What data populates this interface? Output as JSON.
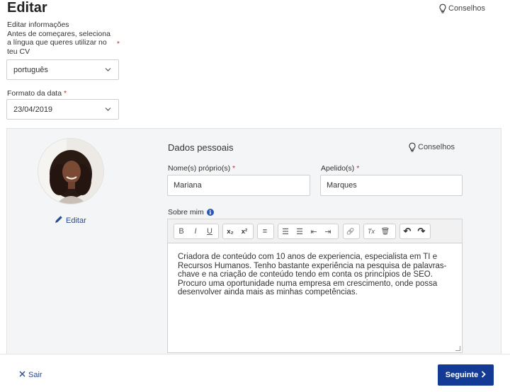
{
  "header": {
    "title": "Editar",
    "tips_label": "Conselhos"
  },
  "intro": {
    "heading": "Editar informações",
    "language_prompt": "Antes de começares, seleciona a língua que queres utilizar no teu CV",
    "required_mark": "*"
  },
  "language_select": {
    "value": "português"
  },
  "date_format": {
    "label": "Formato da data",
    "required_mark": "*",
    "value": "23/04/2019"
  },
  "profile_photo": {
    "edit_label": "Editar"
  },
  "personal": {
    "section_title": "Dados pessoais",
    "tips_label": "Conselhos",
    "first_name_label": "Nome(s) próprio(s)",
    "first_name_value": "Mariana",
    "last_name_label": "Apelido(s)",
    "last_name_value": "Marques",
    "required_mark": "*",
    "about_label": "Sobre mim",
    "info_glyph": "i"
  },
  "toolbar": {
    "bold": "B",
    "italic": "I",
    "underline": "U",
    "subscript": "x₂",
    "superscript": "x²",
    "align": "≡",
    "numbered_list": "☰",
    "bullet_list": "☰",
    "outdent": "⇤",
    "indent": "⇥",
    "link": "🔗",
    "clear_format": "Tx",
    "delete": "🗑",
    "undo": "↶",
    "redo": "↷"
  },
  "about_text": "Criadora de conteúdo com 10 anos de experiencia, especialista em TI e Recursos Humanos. Tenho bastante experiência na pesquisa de palavras-chave e na criação de conteúdo tendo em conta os princípios de SEO. Procuro uma oportunidade numa empresa em crescimento, onde possa desenvolver ainda mais as minhas competências.",
  "footer": {
    "exit_label": "Sair",
    "next_label": "Seguinte"
  },
  "colors": {
    "primary": "#133a95",
    "link": "#2a4a8f",
    "required": "#d7262b",
    "panel_bg": "#f4f5f7"
  }
}
